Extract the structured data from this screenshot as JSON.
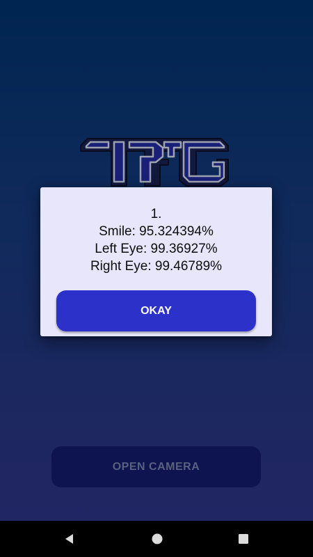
{
  "app": {
    "main_button_label": "OPEN CAMERA"
  },
  "dialog": {
    "lines": [
      "1.",
      "Smile: 95.324394%",
      "Left Eye: 99.36927%",
      "Right Eye: 99.46789%"
    ],
    "button_label": "OKAY"
  },
  "nav_bar": {
    "icons": [
      "back-icon",
      "home-icon",
      "recents-icon"
    ]
  },
  "colors": {
    "dialog_background": "#e8e6fb",
    "accent_button": "#2c31c9",
    "background_top": "#002550",
    "background_bottom": "#222564"
  }
}
